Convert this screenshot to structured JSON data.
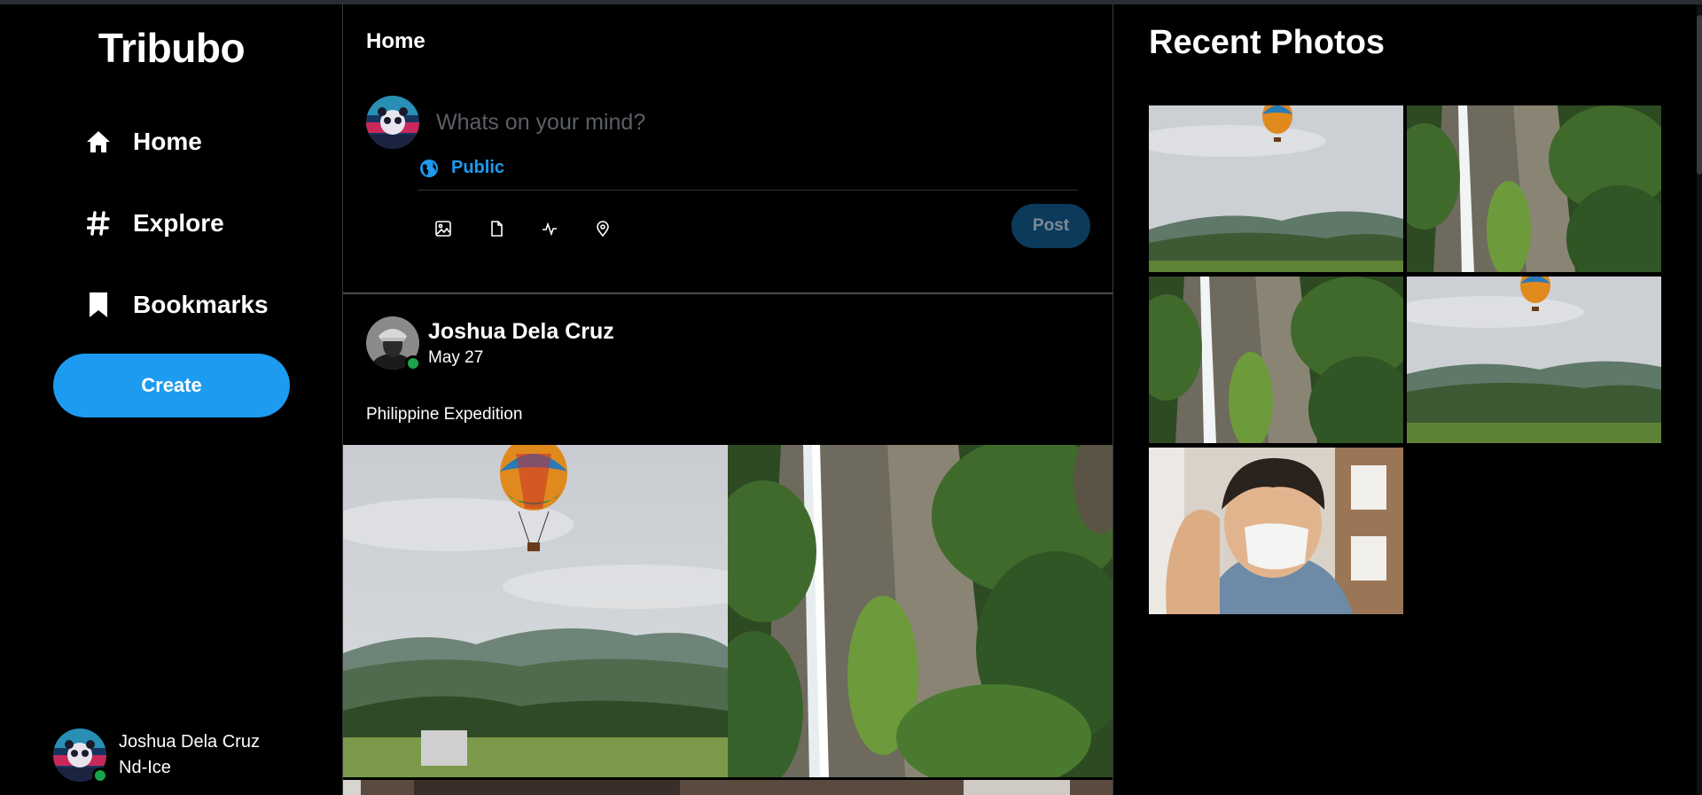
{
  "app": {
    "name": "Tribubo"
  },
  "sidebar": {
    "items": [
      {
        "label": "Home",
        "icon": "home-icon"
      },
      {
        "label": "Explore",
        "icon": "hashtag-icon"
      },
      {
        "label": "Bookmarks",
        "icon": "bookmark-icon"
      }
    ],
    "create_label": "Create",
    "user": {
      "name": "Joshua Dela Cruz",
      "handle": "Nd-Ice",
      "online": true
    }
  },
  "main": {
    "title": "Home",
    "composer": {
      "placeholder": "Whats on your mind?",
      "audience": "Public",
      "tools": [
        "image-icon",
        "file-icon",
        "activity-icon",
        "location-icon"
      ],
      "post_label": "Post"
    },
    "post": {
      "author": "Joshua Dela Cruz",
      "date": "May 27",
      "text": "Philippine Expedition",
      "images": [
        "hot-air-balloon-landscape",
        "waterfall-cliff"
      ]
    }
  },
  "recent": {
    "title": "Recent Photos",
    "photos": [
      "hot-air-balloon-landscape",
      "waterfall-cliff",
      "waterfall-cliff",
      "hot-air-balloon-landscape",
      "person-with-mask"
    ]
  },
  "colors": {
    "accent": "#1d9bf0",
    "background": "#000000",
    "online": "#1aa34a",
    "post_button_disabled": "#0c3a5b"
  }
}
